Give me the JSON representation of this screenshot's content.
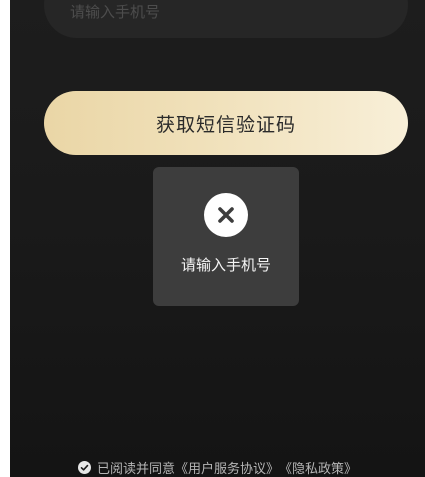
{
  "phone_input": {
    "placeholder": "请输入手机号"
  },
  "sms_button": {
    "label": "获取短信验证码"
  },
  "toast": {
    "icon": "close-icon",
    "message": "请输入手机号"
  },
  "agreement": {
    "icon": "check-circle-icon",
    "prefix": "已阅读并同意",
    "user_agreement": "《用户服务协议》",
    "privacy_policy": "《隐私政策》"
  },
  "colors": {
    "background": "#1a1a1a",
    "input_background": "#262626",
    "button_gradient_start": "#ead6a6",
    "button_gradient_end": "#f8efd8",
    "toast_background": "#3d3d3d"
  }
}
